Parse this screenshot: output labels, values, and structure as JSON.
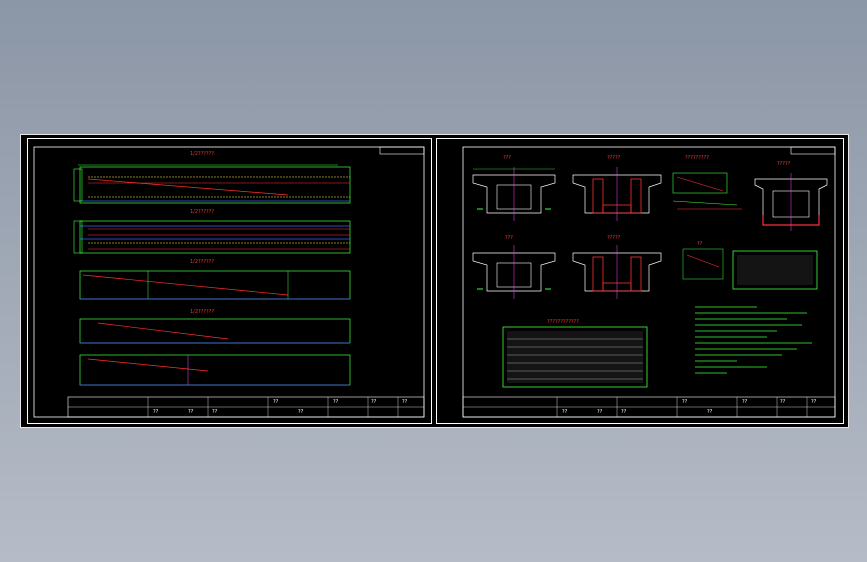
{
  "left_sheet": {
    "view_titles": [
      "1/2??????",
      "1/2??????",
      "1/2??????",
      "1/2??????"
    ],
    "title_block": [
      "??",
      "??",
      "??",
      "??",
      "??",
      "??",
      "??",
      "??"
    ]
  },
  "right_sheet": {
    "section_titles": [
      "???",
      "?????",
      "?????????",
      "?????",
      "???",
      "?????"
    ],
    "table_title": "????????????",
    "detail_title": "??",
    "title_block": [
      "??",
      "??",
      "??",
      "??",
      "??",
      "??",
      "??",
      "??"
    ]
  },
  "colors": {
    "background": "#000000",
    "green": "#40ff40",
    "red": "#ff3030",
    "magenta": "#ff40ff",
    "yellow": "#ffff40",
    "blue": "#4060ff"
  }
}
